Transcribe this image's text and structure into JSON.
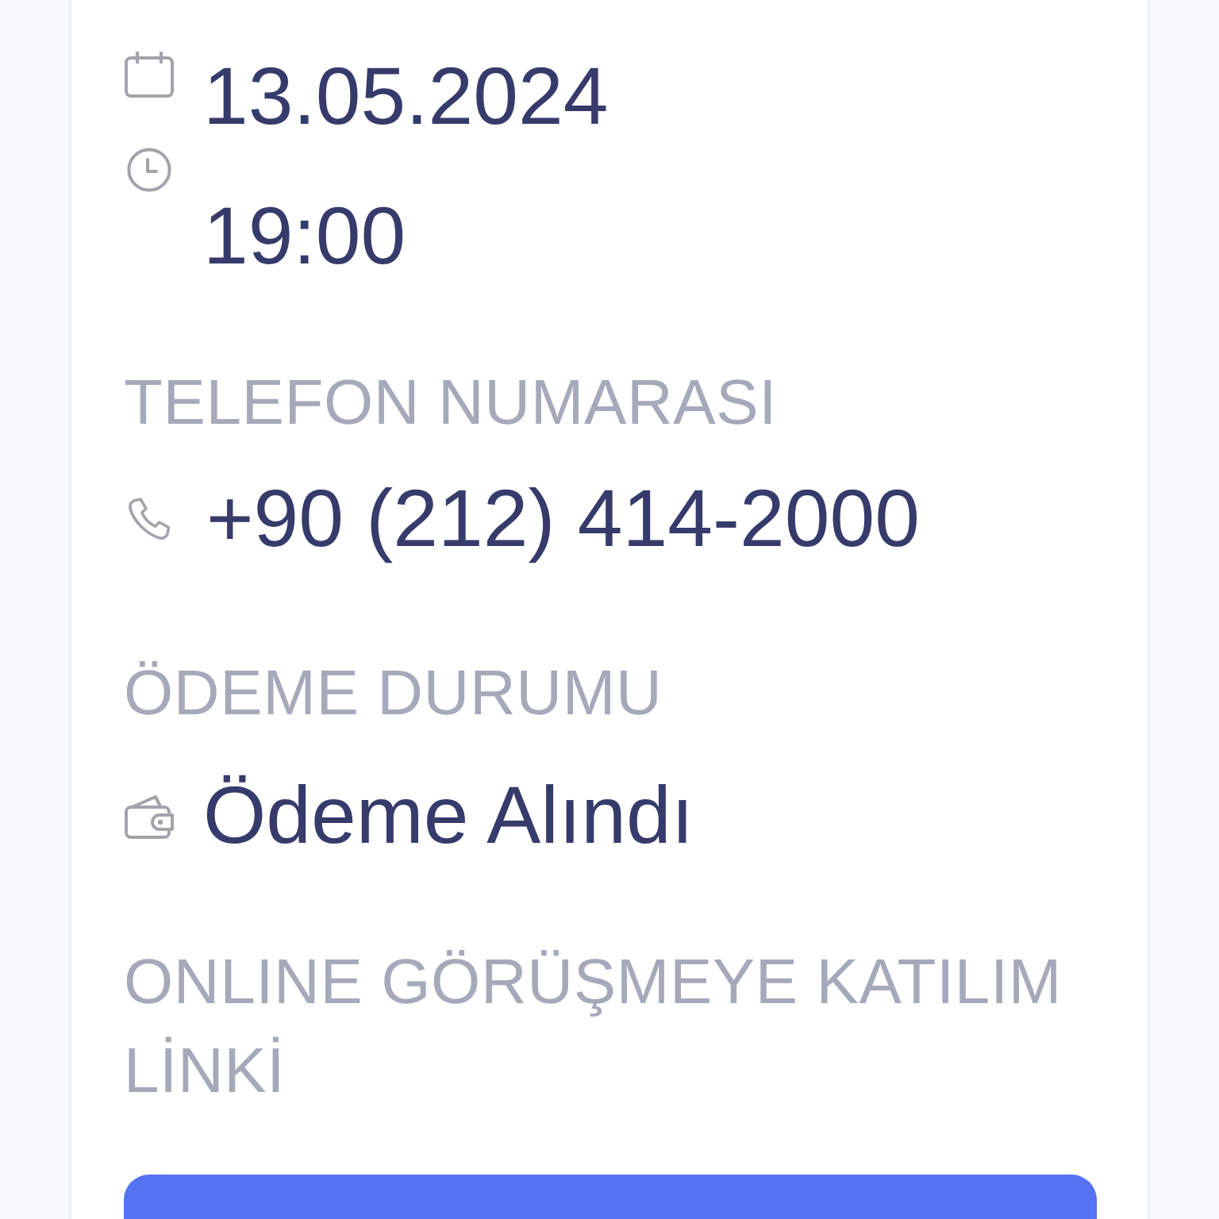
{
  "schedule": {
    "date": "13.05.2024",
    "time": "19:00"
  },
  "fields": [
    {
      "kind": "phone",
      "label": "TELEFON NUMARASI",
      "value": "+90 (212) 414-2000"
    },
    {
      "kind": "payment",
      "label": "ÖDEME DURUMU",
      "value": "Ödeme Alındı"
    }
  ],
  "link_section": {
    "label": "ONLINE GÖRÜŞMEYE KATILIM LİNKİ"
  }
}
